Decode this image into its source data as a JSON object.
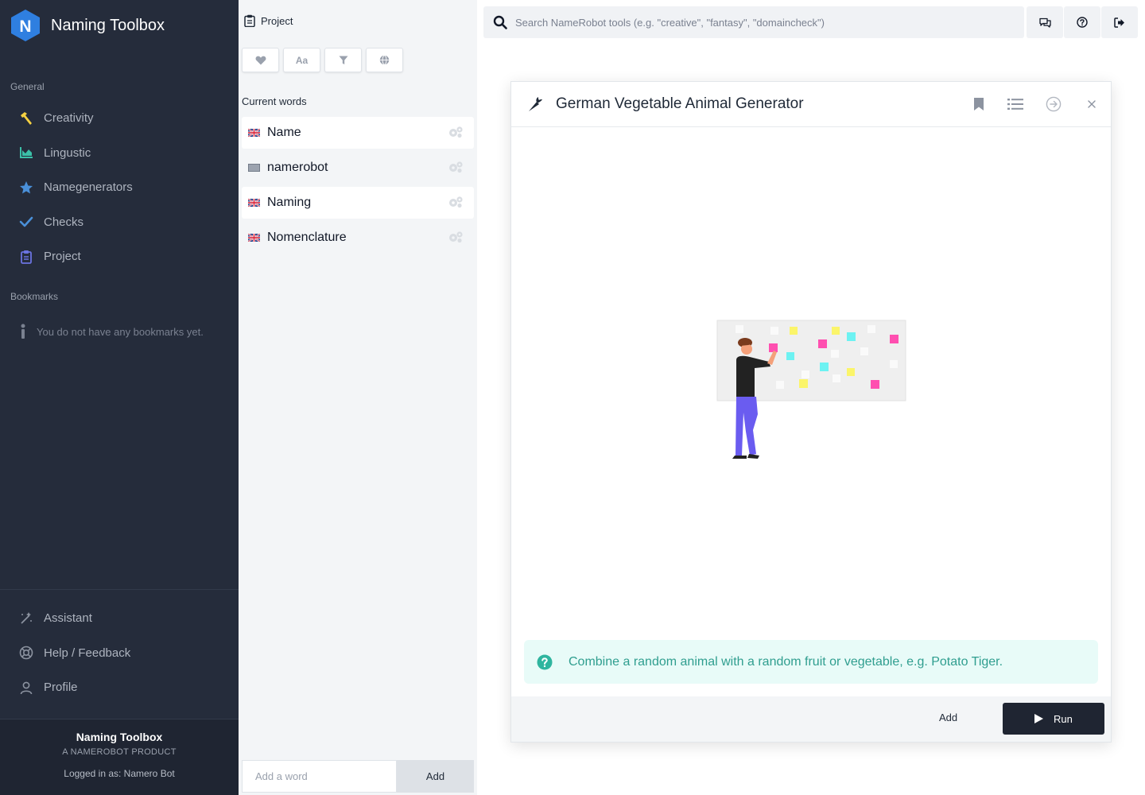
{
  "app": {
    "name": "Naming Toolbox"
  },
  "sidebar": {
    "general_label": "General",
    "items": [
      {
        "label": "Creativity",
        "icon": "hammer-icon",
        "color": "#f5d142"
      },
      {
        "label": "Lingustic",
        "icon": "chart-area-icon",
        "color": "#3bc0a8"
      },
      {
        "label": "Namegenerators",
        "icon": "star-badge-icon",
        "color": "#4a90d9"
      },
      {
        "label": "Checks",
        "icon": "check-icon",
        "color": "#4a90d9"
      },
      {
        "label": "Project",
        "icon": "clipboard-icon",
        "color": "#6b73e0"
      }
    ],
    "bookmarks_label": "Bookmarks",
    "bookmarks_empty": "You do not have any bookmarks yet.",
    "bottom_items": [
      {
        "label": "Assistant",
        "icon": "magic-wand-icon"
      },
      {
        "label": "Help / Feedback",
        "icon": "lifebuoy-icon"
      },
      {
        "label": "Profile",
        "icon": "user-icon"
      }
    ],
    "footer": {
      "title": "Naming Toolbox",
      "subtitle": "A NAMEROBOT PRODUCT",
      "logged_in": "Logged in as: Namero Bot"
    }
  },
  "project": {
    "title": "Project",
    "toolbar": [
      "heart-icon",
      "font-case-icon",
      "filter-icon",
      "globe-icon"
    ],
    "current_words_label": "Current words",
    "words": [
      {
        "text": "Name",
        "flag": "uk-flag-icon"
      },
      {
        "text": "namerobot",
        "flag": "generic-flag-icon"
      },
      {
        "text": "Naming",
        "flag": "uk-flag-icon"
      },
      {
        "text": "Nomenclature",
        "flag": "uk-flag-icon"
      }
    ],
    "add_placeholder": "Add a word",
    "add_button": "Add"
  },
  "topbar": {
    "search_placeholder": "Search NameRobot tools (e.g. \"creative\", \"fantasy\", \"domaincheck\")",
    "buttons": [
      "chat-icon",
      "help-icon",
      "logout-icon"
    ]
  },
  "modal": {
    "title": "German Vegetable Animal Generator",
    "header_icon": "carrot-icon",
    "description": "Combine a random animal with a random fruit or vegetable, e.g. Potato Tiger.",
    "add_label": "Add",
    "run_label": "Run"
  },
  "colors": {
    "sidebar_bg": "#252c3b",
    "accent_dark": "#1f2532",
    "info_text": "#2f9e8f",
    "info_bg": "#e8fbf8"
  }
}
